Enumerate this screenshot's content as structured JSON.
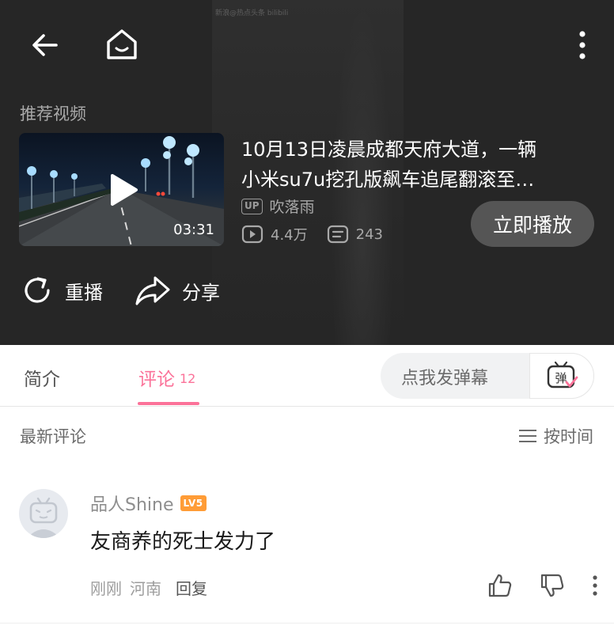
{
  "player": {
    "watermark": "新浪@热点头条 bilibili",
    "recommend_label": "推荐视频",
    "video": {
      "duration": "03:31",
      "title_line1": "10月13日凌晨成都天府大道，一辆",
      "title_line2": "小米su7u挖孔版飙车追尾翻滚至…",
      "up_badge": "UP",
      "uploader": "吹落雨",
      "views": "4.4万",
      "danmaku_count": "243"
    },
    "play_now": "立即播放",
    "replay": "重播",
    "share": "分享"
  },
  "tabs": {
    "intro": "简介",
    "comments": "评论",
    "comments_count": "12",
    "danmaku_placeholder": "点我发弹幕",
    "danmaku_icon_char": "弹",
    "accent": "#fb7299"
  },
  "comments": {
    "section_label": "最新评论",
    "sort_label": "按时间",
    "items": [
      {
        "user": "品人Shine",
        "level": "LV5",
        "text": "友商养的死士发力了",
        "time": "刚刚",
        "location": "河南",
        "reply": "回复"
      }
    ]
  }
}
